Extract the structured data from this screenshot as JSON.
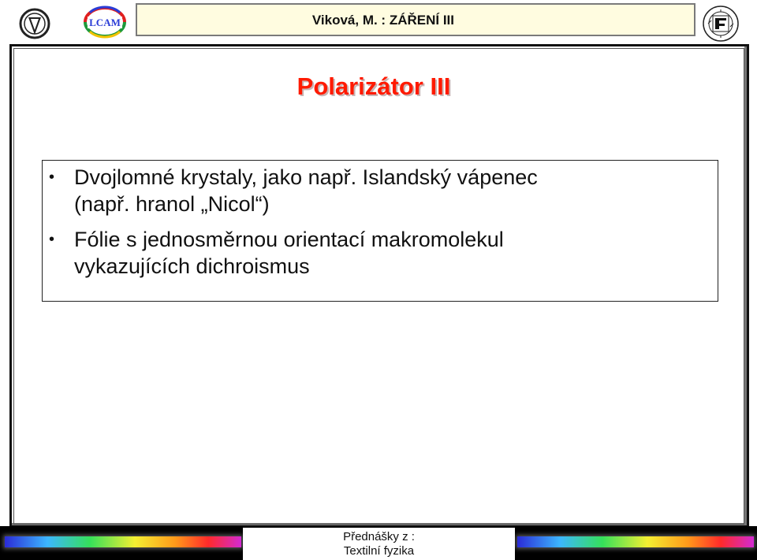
{
  "header": {
    "title": "Viková, M. : ZÁŘENÍ III",
    "left_logo_icon": "liberec-university-logo",
    "lcam_logo_text": "LCAM",
    "right_logo_icon": "technical-university-seal"
  },
  "slide": {
    "title": "Polarizátor III",
    "bullets": [
      {
        "line1": "Dvojlomné krystaly, jako např. Islandský vápenec",
        "line2": "(např. hranol „Nicol“)"
      },
      {
        "line1": "Fólie s jednosměrnou orientací makromolekul",
        "line2": "vykazujících dichroismus"
      }
    ]
  },
  "footer": {
    "line1": "Přednášky z :",
    "line2": "Textilní fyzika"
  },
  "colors": {
    "title": "#ff1a00",
    "header_box_bg": "#fffce0"
  }
}
